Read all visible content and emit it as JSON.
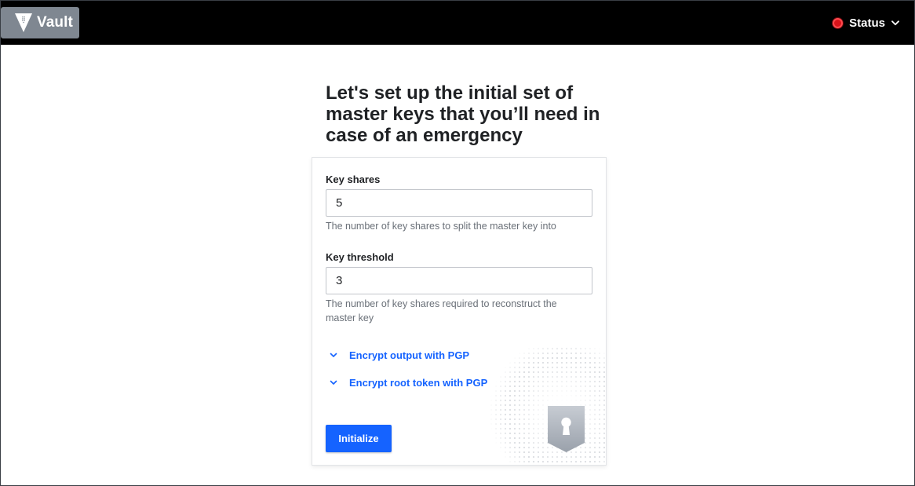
{
  "header": {
    "brand": "Vault",
    "status_label": "Status",
    "status_color": "#d8131a"
  },
  "main": {
    "title": "Let's set up the initial set of master keys that you’ll need in case of an emergency"
  },
  "form": {
    "key_shares": {
      "label": "Key shares",
      "value": "5",
      "help": "The number of key shares to split the master key into"
    },
    "key_threshold": {
      "label": "Key threshold",
      "value": "3",
      "help": "The number of key shares required to reconstruct the master key"
    },
    "toggles": [
      {
        "label": "Encrypt output with PGP",
        "icon": "chevron-down-icon"
      },
      {
        "label": "Encrypt root token with PGP",
        "icon": "chevron-down-icon"
      }
    ],
    "submit_label": "Initialize"
  },
  "colors": {
    "accent": "#1563ff",
    "topbar": "#000000",
    "brand_bg": "#7f8791"
  }
}
